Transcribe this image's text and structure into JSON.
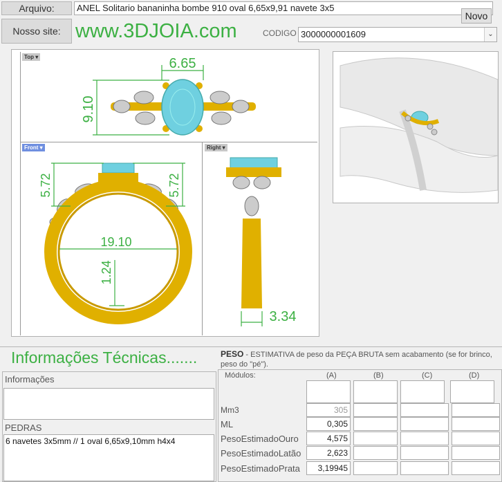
{
  "header": {
    "arquivo_label": "Arquivo:",
    "arquivo_value": "ANEL Solitario bananinha bombe 910 oval 6,65x9,91 navete 3x5",
    "novo_button": "Novo",
    "site_label": "Nosso site:",
    "site_url": "www.3DJOIA.com",
    "codigo_label": "CODIGO",
    "codigo_value": "3000000001609"
  },
  "viewports": {
    "top": {
      "tag": "Top",
      "width_dim": "6.65",
      "height_dim": "9.10"
    },
    "front": {
      "tag": "Front",
      "left_dim": "5.72",
      "right_dim": "5.72",
      "inner_dim": "19.10",
      "shank_dim": "1.24"
    },
    "right": {
      "tag": "Right",
      "thickness_dim": "3.34"
    }
  },
  "info": {
    "section_title": "Informações Técnicas.......",
    "informacoes_label": "Informações",
    "informacoes_value": "",
    "pedras_label": "PEDRAS",
    "pedras_value": "6 navetes 3x5mm // 1 oval 6,65x9,10mm h4x4"
  },
  "peso": {
    "title": "PESO",
    "description": " -  ESTIMATIVA de peso da PEÇA BRUTA sem acabamento (se for brinco, peso do \"pé\").",
    "modulos_label": "Módulos:",
    "columns": [
      "(A)",
      "(B)",
      "(C)",
      "(D)"
    ],
    "rows": [
      {
        "label": "Mm3",
        "a": "305"
      },
      {
        "label": "ML",
        "a": "0,305"
      },
      {
        "label": "PesoEstimadoOuro",
        "a": "4,575"
      },
      {
        "label": "PesoEstimadoLatão",
        "a": "2,623"
      },
      {
        "label": "PesoEstimadoPrata",
        "a": "3,19945"
      }
    ]
  },
  "colors": {
    "accent_green": "#3cb043",
    "gold": "#e0b000",
    "stone_blue": "#6fd0e0"
  }
}
